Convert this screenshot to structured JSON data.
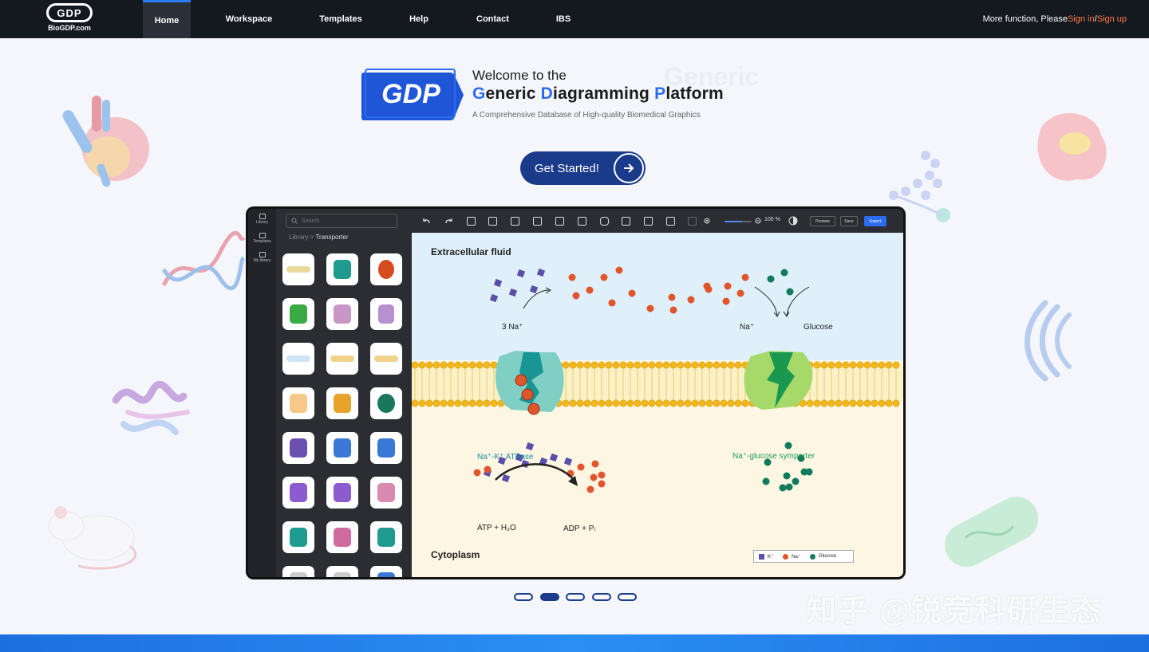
{
  "nav": {
    "logo_text": "BioGDP.com",
    "logo_mark": "GDP",
    "items": [
      {
        "label": "Home",
        "active": true
      },
      {
        "label": "Workspace"
      },
      {
        "label": "Templates"
      },
      {
        "label": "Help"
      },
      {
        "label": "Contact"
      },
      {
        "label": "IBS"
      }
    ],
    "right_prefix": "More function, Please ",
    "sign_in": "Sign in",
    "separator": " / ",
    "sign_up": "Sign up"
  },
  "hero": {
    "logo_text": "GDP",
    "welcome": "Welcome to the",
    "platform": {
      "g": "G",
      "eneric": "eneric ",
      "d": "D",
      "iagramming": "iagramming ",
      "p": "P",
      "latform": "latform"
    },
    "subtitle": "A Comprehensive Database of High-quality Biomedical Graphics",
    "ghost": "Generic",
    "cta": "Get Started!"
  },
  "editor": {
    "rail": [
      "Library",
      "Templates",
      "My library"
    ],
    "search_placeholder": "Search",
    "breadcrumb": {
      "root": "Library",
      "sep": ">",
      "current": "Transporter"
    },
    "zoom": "100 %",
    "zoom_level": 0.65,
    "buttons": {
      "preview": "Preview",
      "save": "Save",
      "export": "Export"
    },
    "canvas": {
      "extracellular": "Extracellular fluid",
      "cytoplasm": "Cytoplasm",
      "na3": "3 Na⁺",
      "na": "Na⁺",
      "glucose": "Glucose",
      "atpase": "Na⁺-K⁺ ATPase",
      "symporter": "Na⁺-glucose symporter",
      "atp": "ATP + H₂O",
      "adp": "ADP + Pᵢ",
      "legend": [
        "K⁺",
        "Na⁺",
        "Glucose"
      ]
    }
  },
  "carousel": {
    "count": 5,
    "active": 1
  },
  "watermark": "知乎 @锐竞科研生态",
  "colors": {
    "accent": "#2b6cf0",
    "navy": "#1a3a8a",
    "link": "#ff7a45",
    "k": "#5b4ea8",
    "na": "#e0552c",
    "glucose": "#127a5c"
  }
}
